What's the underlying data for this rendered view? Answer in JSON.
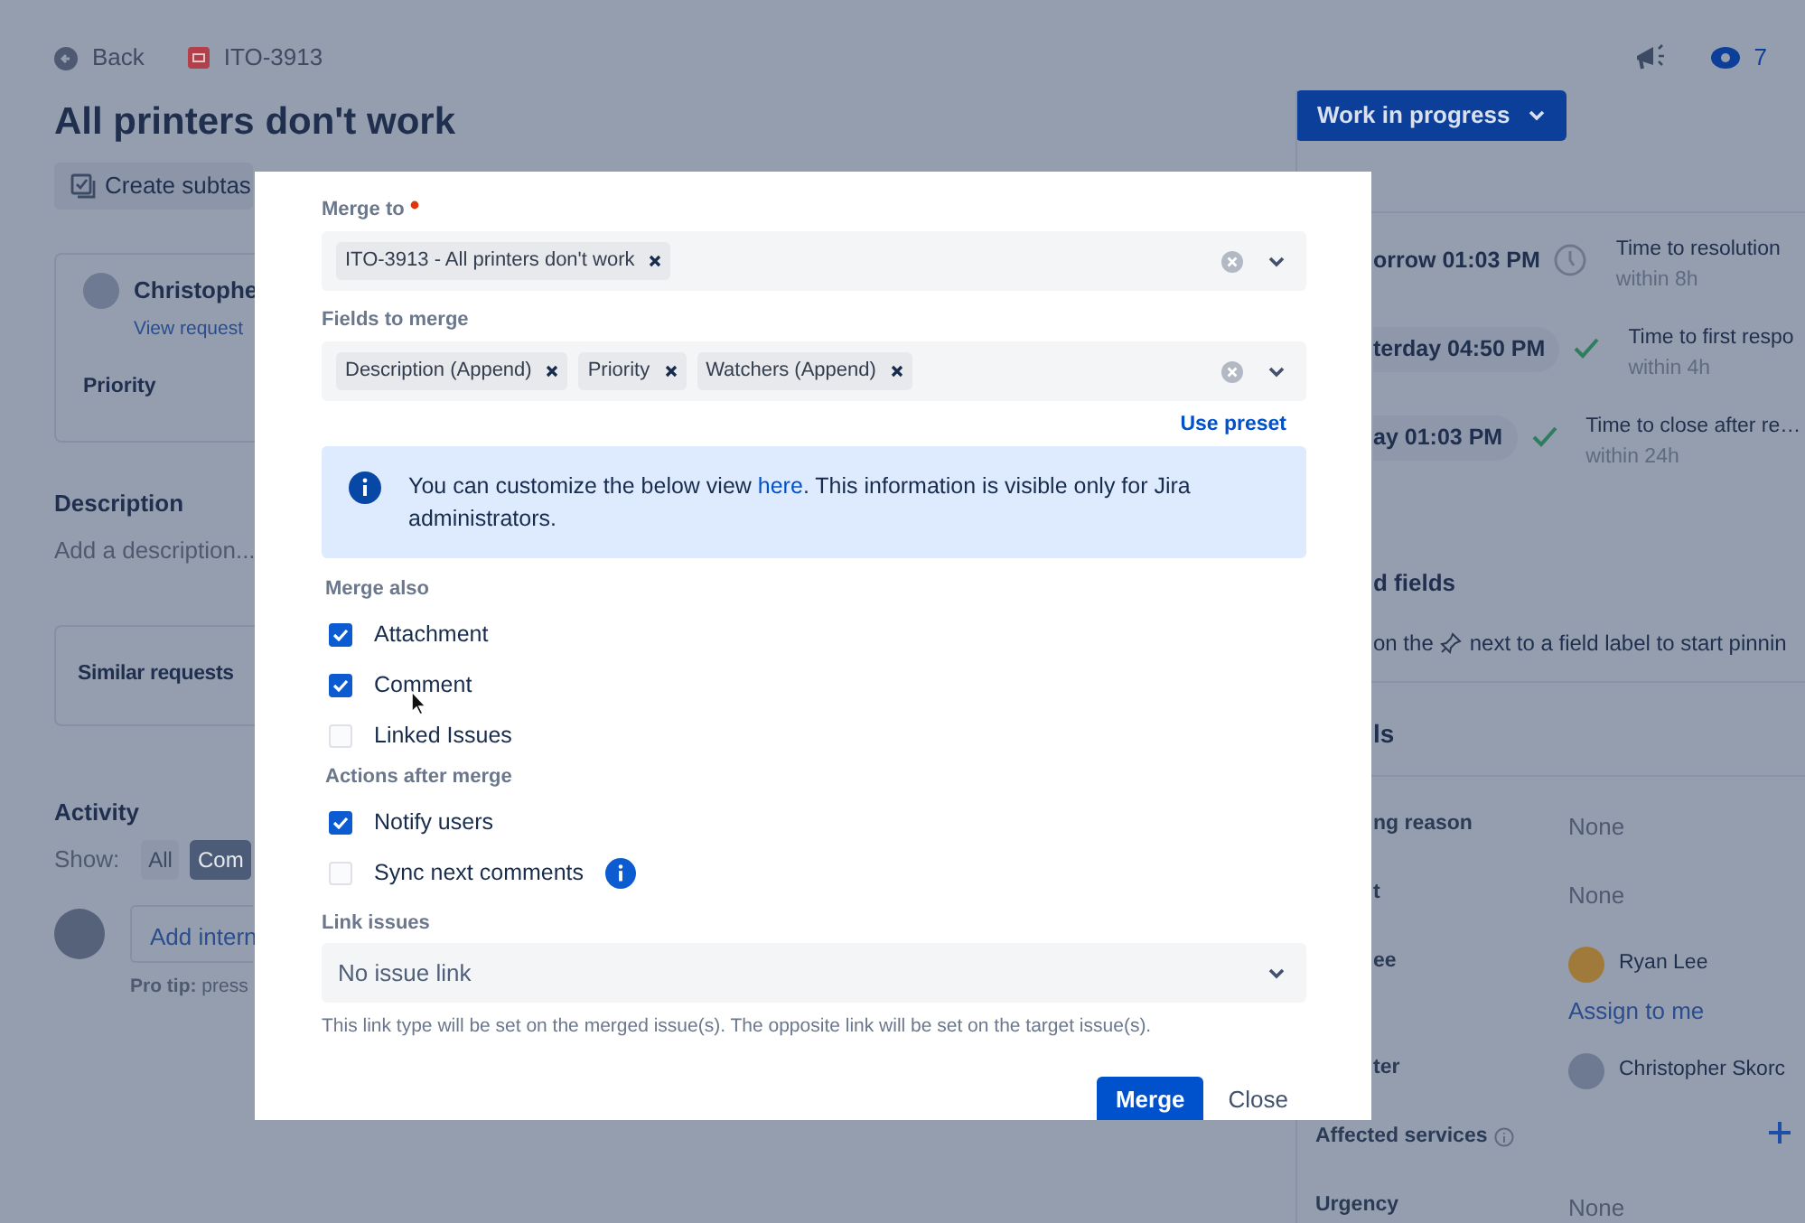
{
  "header": {
    "back": "Back",
    "issue_key": "ITO-3913",
    "watch_count": "7"
  },
  "title": "All printers don't work",
  "toolbar": {
    "create_subtask": "Create subtas"
  },
  "reporter_card": {
    "name": "Christophe",
    "link": "View request",
    "field": "Priority"
  },
  "description": {
    "heading": "Description",
    "placeholder": "Add a description..."
  },
  "similar_requests": {
    "heading": "Similar requests"
  },
  "activity": {
    "heading": "Activity",
    "show_label": "Show:",
    "filters": [
      {
        "label": "All",
        "selected": false
      },
      {
        "label": "Com",
        "selected": true
      }
    ],
    "comment_field": "Add intern",
    "pro_tip": "**Pro tip:** press"
  },
  "status_button": "Work in progress",
  "slas": [
    {
      "time": "orrow 01:03 PM",
      "kind": "running",
      "title": "Time to resolution",
      "goal": "within 8h"
    },
    {
      "time": "terday 04:50 PM",
      "kind": "met",
      "title": "Time to first respo",
      "goal": "within 4h"
    },
    {
      "time": "ay 01:03 PM",
      "kind": "met",
      "title": "Time to close after re…",
      "goal": "within 24h"
    }
  ],
  "pinned": {
    "heading": "d fields",
    "hint_before": "on the",
    "hint_after": "next to a field label to start pinnin"
  },
  "details": {
    "heading": "ls",
    "fields": [
      {
        "label": "ng reason",
        "kind": "text",
        "value": "None"
      },
      {
        "label": "t",
        "kind": "text",
        "value": "None"
      },
      {
        "label": "ee",
        "kind": "user",
        "value": "Ryan Lee",
        "action": "Assign to me"
      },
      {
        "label": "ter",
        "kind": "user",
        "value": "Christopher Skorc"
      },
      {
        "label": "Affected services",
        "kind": "add"
      },
      {
        "label": "Urgency",
        "kind": "text",
        "value": "None"
      }
    ]
  },
  "dialog": {
    "merge_to": {
      "label": "Merge to",
      "required": true,
      "chips": [
        "ITO-3913 - All printers don't work"
      ]
    },
    "fields_to_merge": {
      "label": "Fields to merge",
      "required": false,
      "chips": [
        "Description (Append)",
        "Priority",
        "Watchers (Append)"
      ]
    },
    "use_preset": "Use preset",
    "info": {
      "before": "You can customize the below view ",
      "link": "here",
      "after": ". This information is visible only for Jira administrators."
    },
    "merge_also": {
      "label": "Merge also",
      "options": [
        {
          "label": "Attachment",
          "checked": true,
          "has_info": false
        },
        {
          "label": "Comment",
          "checked": true,
          "has_info": false
        },
        {
          "label": "Linked Issues",
          "checked": false,
          "has_info": false
        }
      ]
    },
    "actions_after_merge": {
      "label": "Actions after merge",
      "options": [
        {
          "label": "Notify users",
          "checked": true,
          "has_info": false
        },
        {
          "label": "Sync next comments",
          "checked": false,
          "has_info": true
        }
      ]
    },
    "link_issues": {
      "label": "Link issues",
      "value": "No issue link",
      "help": "This link type will be set on the merged issue(s). The opposite link will be set on the target issue(s)."
    },
    "buttons": {
      "primary": "Merge",
      "secondary": "Close"
    }
  }
}
